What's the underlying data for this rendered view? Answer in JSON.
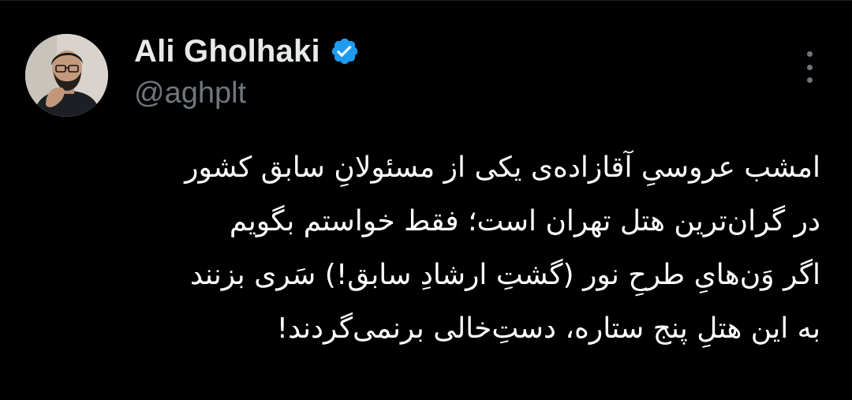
{
  "author": {
    "display_name": "Ali Gholhaki",
    "handle": "@aghplt",
    "verified": true,
    "verified_color": "#1d9bf0"
  },
  "tweet": {
    "lines": [
      "امشب عروسیِ آقازاده‌ی یکی از مسئولانِ سابق کشور",
      "در گران‌ترین هتل تهران است؛ فقط خواستم بگویم",
      "اگر وَن‌هایِ طرحِ نور (گشتِ ارشادِ سابق!) سَری بزنند",
      "به این هتلِ پنج ستاره، دستِ‌خالی برنمی‌گردند!"
    ]
  },
  "icons": {
    "verified": "verified-badge-icon",
    "more": "more-options-icon"
  },
  "colors": {
    "background": "#000000",
    "text": "#ffffff",
    "muted": "#71767b",
    "accent": "#1d9bf0"
  }
}
